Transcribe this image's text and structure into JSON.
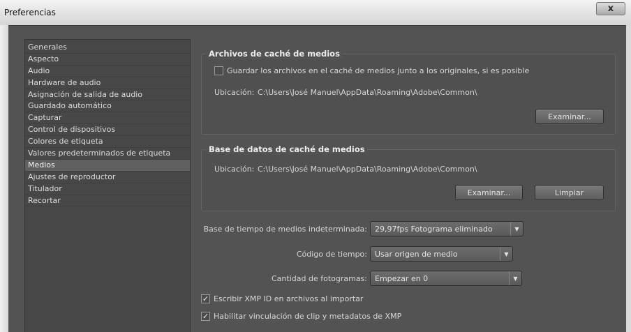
{
  "window": {
    "title": "Preferencias",
    "close_label": "x"
  },
  "categories": [
    {
      "label": "Generales"
    },
    {
      "label": "Aspecto"
    },
    {
      "label": "Audio"
    },
    {
      "label": "Hardware de audio"
    },
    {
      "label": "Asignación de salida de audio"
    },
    {
      "label": "Guardado automático"
    },
    {
      "label": "Capturar"
    },
    {
      "label": "Control de dispositivos"
    },
    {
      "label": "Colores de etiqueta"
    },
    {
      "label": "Valores predeterminados de etiqueta"
    },
    {
      "label": "Medios"
    },
    {
      "label": "Ajustes de reproductor"
    },
    {
      "label": "Titulador"
    },
    {
      "label": "Recortar"
    }
  ],
  "selected_category": "Medios",
  "cache_files": {
    "title": "Archivos de caché de medios",
    "checkbox_label": "Guardar los archivos en el caché de medios junto a los originales, si es posible",
    "checkbox_checked": false,
    "location_label": "Ubicación:",
    "location_value": "C:\\Users\\José Manuel\\AppData\\Roaming\\Adobe\\Common\\",
    "browse_label": "Examinar..."
  },
  "cache_db": {
    "title": "Base de datos de caché de medios",
    "location_label": "Ubicación:",
    "location_value": "C:\\Users\\José Manuel\\AppData\\Roaming\\Adobe\\Common\\",
    "browse_label": "Examinar...",
    "clean_label": "Limpiar"
  },
  "settings": {
    "timebase_label": "Base de tiempo de medios indeterminada:",
    "timebase_value": "29,97fps Fotograma eliminado",
    "timecode_label": "Código de tiempo:",
    "timecode_value": "Usar origen de medio",
    "framecount_label": "Cantidad de fotogramas:",
    "framecount_value": "Empezar en 0",
    "xmp_write_label": "Escribir XMP ID en archivos al importar",
    "xmp_write_checked": true,
    "xmp_link_label": "Habilitar vinculación de clip y metadatos de XMP",
    "xmp_link_checked": true
  },
  "icons": {
    "dropdown": "chevron-down-icon",
    "checkbox_checked": "checkmark-icon",
    "close": "close-icon"
  }
}
